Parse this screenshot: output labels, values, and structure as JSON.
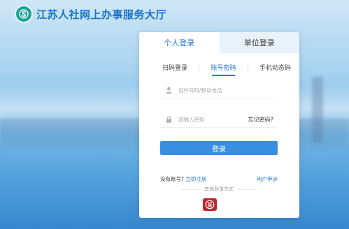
{
  "header": {
    "title": "江苏人社网上办事服务大厅",
    "logo_icon": "s-logo-icon"
  },
  "tabs": [
    {
      "label": "个人登录",
      "active": true
    },
    {
      "label": "单位登录",
      "active": false
    }
  ],
  "subtabs": [
    {
      "label": "扫码登录",
      "active": false
    },
    {
      "label": "账号密码",
      "active": true
    },
    {
      "label": "手机动态码",
      "active": false
    }
  ],
  "form": {
    "account_placeholder": "证件号码/移动电话",
    "password_placeholder": "请输入密码",
    "forgot_label": "忘记密码?",
    "login_label": "登录"
  },
  "register": {
    "prompt": "没有账号?",
    "link": "立即注册",
    "user_apply": "用户申诉"
  },
  "other_login": {
    "label": "其他登录方式",
    "icon": "bank-app-icon"
  },
  "colors": {
    "primary": "#3a8ee0",
    "title": "#1a72c8",
    "other_icon": "#c4222c"
  }
}
